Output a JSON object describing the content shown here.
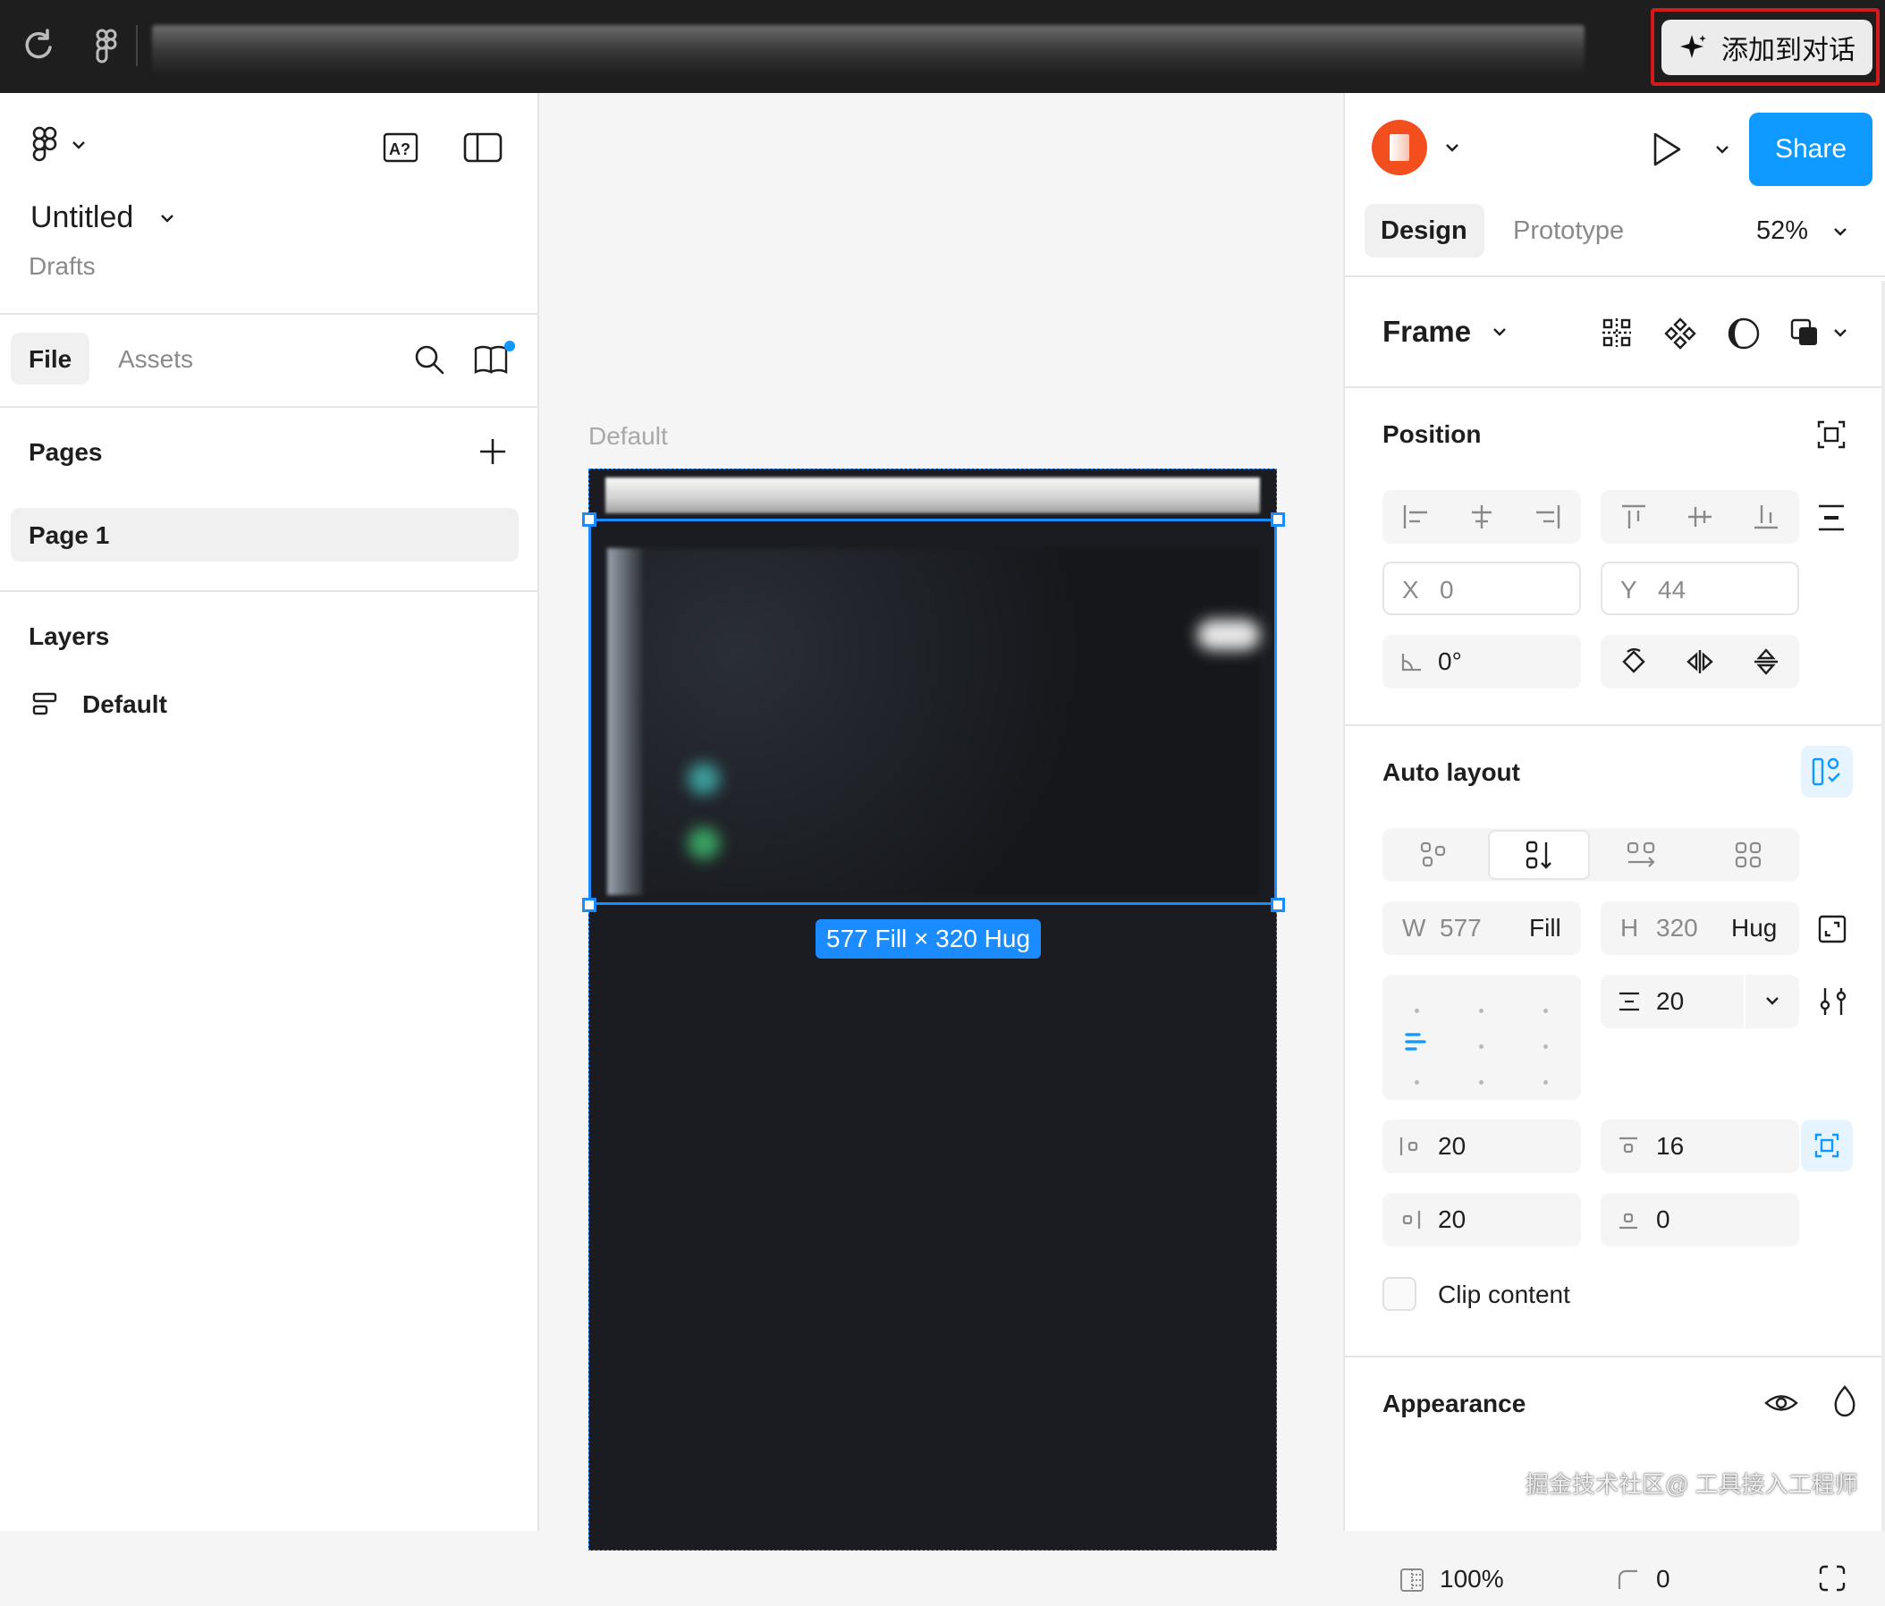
{
  "topbar": {
    "add_to_chat_label": "添加到对话",
    "icons": [
      "refresh-icon",
      "figma-icon",
      "sparkle-icon"
    ]
  },
  "left": {
    "file_title": "Untitled",
    "file_location": "Drafts",
    "tabs": [
      "File",
      "Assets"
    ],
    "pages_header": "Pages",
    "page_item": "Page 1",
    "layers_header": "Layers",
    "layer_item": "Default"
  },
  "canvas": {
    "frame_label": "Default",
    "size_badge": "577 Fill × 320 Hug",
    "frame_bg": "#1a1c21",
    "selection_color": "#1a8cff"
  },
  "right": {
    "share_label": "Share",
    "tabs": [
      "Design",
      "Prototype"
    ],
    "zoom": "52%",
    "frame_type": "Frame",
    "position": {
      "header": "Position",
      "x_label": "X",
      "x_value": "0",
      "y_label": "Y",
      "y_value": "44",
      "rotation": "0°"
    },
    "auto_layout": {
      "header": "Auto layout",
      "w_label": "W",
      "w_value": "577",
      "w_mode": "Fill",
      "h_label": "H",
      "h_value": "320",
      "h_mode": "Hug",
      "gap": "20",
      "pad_left": "20",
      "pad_top": "16",
      "pad_right": "20",
      "pad_bottom": "0",
      "clip_label": "Clip content"
    },
    "appearance": {
      "header": "Appearance",
      "opacity": "100%",
      "radius": "0"
    },
    "accent": "#0d99ff",
    "avatar_color": "#f24e1e"
  },
  "watermark": "掘金技术社区@ 工具接入工程师"
}
